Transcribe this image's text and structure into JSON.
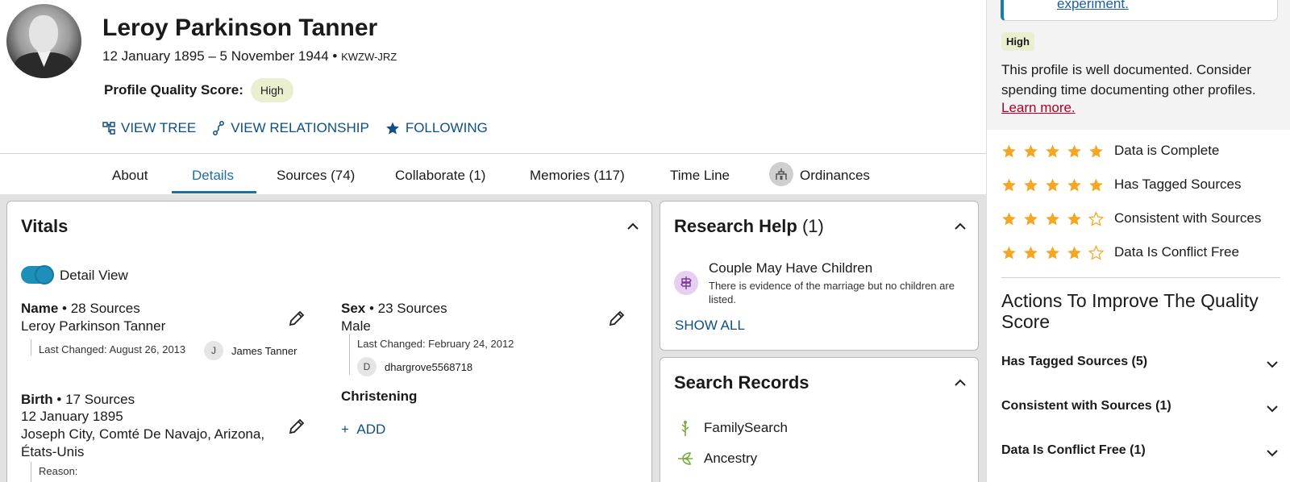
{
  "person": {
    "name": "Leroy Parkinson Tanner",
    "lifespan": "12 January 1895 – 5 November 1944 •",
    "pid": "KWZW-JRZ",
    "quality_label": "Profile Quality Score:",
    "quality_value": "High"
  },
  "actions": {
    "view_tree": "VIEW TREE",
    "view_relationship": "VIEW RELATIONSHIP",
    "following": "FOLLOWING"
  },
  "tabs": [
    {
      "label": "About"
    },
    {
      "label": "Details"
    },
    {
      "label": "Sources (74)"
    },
    {
      "label": "Collaborate (1)"
    },
    {
      "label": "Memories (117)"
    },
    {
      "label": "Time Line"
    },
    {
      "label": "Ordinances"
    }
  ],
  "active_tab": "Details",
  "vitals": {
    "title": "Vitals",
    "detail_view_label": "Detail View",
    "detail_view_on": true,
    "name": {
      "label": "Name",
      "sources": "• 28 Sources",
      "value": "Leroy Parkinson Tanner",
      "changed": "Last Changed: August 26, 2013",
      "user_initial": "J",
      "user": "James Tanner"
    },
    "sex": {
      "label": "Sex",
      "sources": "• 23 Sources",
      "value": "Male",
      "changed": "Last Changed: February 24, 2012",
      "user_initial": "D",
      "user": "dhargrove5568718"
    },
    "birth": {
      "label": "Birth",
      "sources": "• 17 Sources",
      "date": "12 January 1895",
      "place_line1": "Joseph City, Comté De Navajo, Arizona,",
      "place_line2": "États-Unis",
      "reason": "Reason:"
    },
    "christening": {
      "label": "Christening",
      "add": "ADD"
    }
  },
  "research_help": {
    "title": "Research Help",
    "count": "(1)",
    "item_title": "Couple May Have Children",
    "item_desc": "There is evidence of the marriage but no children are listed.",
    "show_all": "SHOW ALL"
  },
  "search_records": {
    "title": "Search Records",
    "items": [
      {
        "label": "FamilySearch",
        "icon": "familysearch-tree-icon",
        "color": "#7aa93c"
      },
      {
        "label": "Ancestry",
        "icon": "ancestry-leaf-icon",
        "color": "#7aa93c"
      }
    ]
  },
  "sidebar": {
    "link_text": "experiment.",
    "badge": "High",
    "description": "This profile is well documented. Consider spending time documenting other profiles.",
    "learn_more": "Learn more.",
    "metrics": [
      {
        "label": "Data is Complete",
        "stars": 5
      },
      {
        "label": "Has Tagged Sources",
        "stars": 5
      },
      {
        "label": "Consistent with Sources",
        "stars": 4
      },
      {
        "label": "Data Is Conflict Free",
        "stars": 4
      }
    ],
    "improve_heading": "Actions To Improve The Quality Score",
    "accordions": [
      {
        "label": "Has Tagged Sources (5)"
      },
      {
        "label": "Consistent with Sources (1)"
      },
      {
        "label": "Data Is Conflict Free (1)"
      }
    ]
  },
  "colors": {
    "accent": "#1d6ea3",
    "link": "#0f4f84",
    "star": "#f5a623",
    "badge_bg": "#eaefcf"
  }
}
